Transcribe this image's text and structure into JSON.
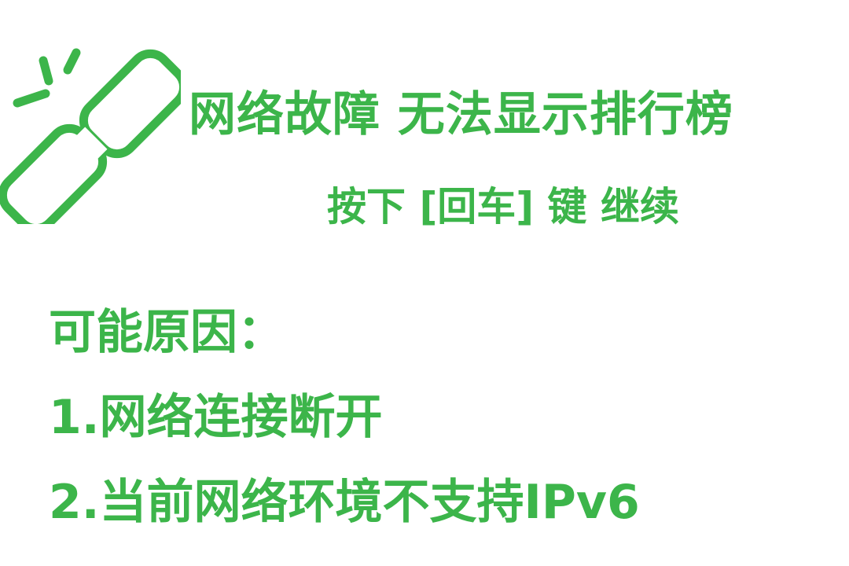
{
  "colors": {
    "accent": "#3cb54a",
    "background": "#ffffff"
  },
  "icon": "broken-link-icon",
  "title": "网络故障 无法显示排行榜",
  "prompt": "按下 [回车] 键 继续",
  "reasons": {
    "heading": "可能原因：",
    "items": [
      "1.网络连接断开",
      "2.当前网络环境不支持IPv6"
    ]
  }
}
